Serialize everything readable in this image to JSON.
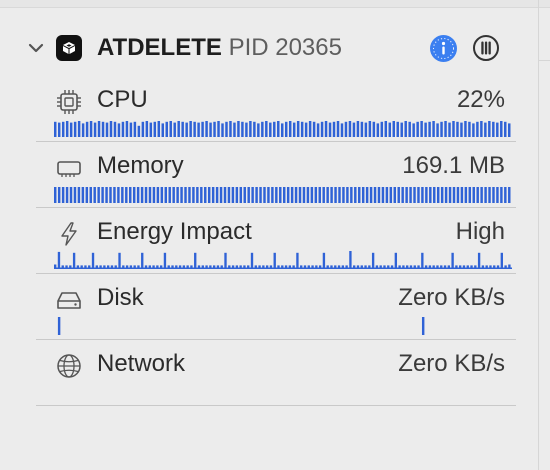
{
  "process": {
    "name": "ATDELETE",
    "pid_text": "PID 20365"
  },
  "icons": {
    "chevron": "chevron-down-icon",
    "app": "app-cube-icon",
    "info": "info-icon",
    "pause": "pause-icon",
    "cpu": "cpu-chip-icon",
    "memory": "memory-icon",
    "energy": "bolt-icon",
    "disk": "disk-icon",
    "network": "globe-icon"
  },
  "colors": {
    "bar": "#2f62d6",
    "accent": "#3b7ff0",
    "background": "#ececec"
  },
  "metrics": [
    {
      "label": "CPU",
      "value": "22%",
      "graph": [
        0.95,
        0.9,
        0.95,
        1,
        0.9,
        0.95,
        1,
        0.85,
        0.95,
        1,
        0.9,
        1,
        0.95,
        0.9,
        1,
        0.95,
        0.85,
        0.95,
        1,
        0.9,
        0.95,
        0.7,
        0.95,
        1,
        0.9,
        0.95,
        1,
        0.85,
        0.95,
        1,
        0.9,
        1,
        0.95,
        0.9,
        1,
        0.95,
        0.9,
        0.95,
        1,
        0.9,
        0.95,
        1,
        0.85,
        0.95,
        1,
        0.9,
        1,
        0.95,
        0.9,
        1,
        0.95,
        0.85,
        0.95,
        1,
        0.9,
        0.95,
        1,
        0.85,
        0.95,
        1,
        0.9,
        1,
        0.95,
        0.9,
        1,
        0.95,
        0.85,
        0.95,
        1,
        0.9,
        0.95,
        1,
        0.85,
        0.95,
        1,
        0.9,
        1,
        0.95,
        0.9,
        1,
        0.95,
        0.85,
        0.95,
        1,
        0.9,
        1,
        0.95,
        0.9,
        1,
        0.95,
        0.85,
        0.95,
        1,
        0.9,
        0.95,
        1,
        0.85,
        0.95,
        1,
        0.9,
        1,
        0.95,
        0.9,
        1,
        0.95,
        0.85,
        0.95,
        1,
        0.9,
        1,
        0.95,
        0.9,
        1,
        0.95,
        0.85
      ]
    },
    {
      "label": "Memory",
      "value": "169.1 MB",
      "graph": [
        1,
        1,
        1,
        1,
        1,
        1,
        1,
        1,
        1,
        1,
        1,
        1,
        1,
        1,
        1,
        1,
        1,
        1,
        1,
        1,
        1,
        1,
        1,
        1,
        1,
        1,
        1,
        1,
        1,
        1,
        1,
        1,
        1,
        1,
        1,
        1,
        1,
        1,
        1,
        1,
        1,
        1,
        1,
        1,
        1,
        1,
        1,
        1,
        1,
        1,
        1,
        1,
        1,
        1,
        1,
        1,
        1,
        1,
        1,
        1,
        1,
        1,
        1,
        1,
        1,
        1,
        1,
        1,
        1,
        1,
        1,
        1,
        1,
        1,
        1,
        1,
        1,
        1,
        1,
        1,
        1,
        1,
        1,
        1,
        1,
        1,
        1,
        1,
        1,
        1,
        1,
        1,
        1,
        1,
        1,
        1,
        1,
        1,
        1,
        1,
        1,
        1,
        1,
        1,
        1,
        1,
        1,
        1,
        1,
        1,
        1,
        1,
        1,
        1,
        1,
        1
      ]
    },
    {
      "label": "Energy Impact",
      "value": "High",
      "graph": [
        0.25,
        0.95,
        0.2,
        0.2,
        0.2,
        0.9,
        0.2,
        0.2,
        0.2,
        0.2,
        0.9,
        0.2,
        0.2,
        0.2,
        0.2,
        0.2,
        0.2,
        0.9,
        0.2,
        0.2,
        0.2,
        0.2,
        0.2,
        0.9,
        0.2,
        0.2,
        0.2,
        0.2,
        0.2,
        0.9,
        0.2,
        0.2,
        0.2,
        0.2,
        0.2,
        0.2,
        0.2,
        0.9,
        0.2,
        0.2,
        0.2,
        0.2,
        0.2,
        0.2,
        0.2,
        0.9,
        0.2,
        0.2,
        0.2,
        0.2,
        0.2,
        0.2,
        0.9,
        0.2,
        0.2,
        0.2,
        0.2,
        0.2,
        0.9,
        0.2,
        0.2,
        0.2,
        0.2,
        0.2,
        0.9,
        0.2,
        0.2,
        0.2,
        0.2,
        0.2,
        0.2,
        0.9,
        0.2,
        0.2,
        0.2,
        0.2,
        0.2,
        0.2,
        1,
        0.2,
        0.2,
        0.2,
        0.2,
        0.2,
        0.9,
        0.2,
        0.2,
        0.2,
        0.2,
        0.2,
        0.9,
        0.2,
        0.2,
        0.2,
        0.2,
        0.2,
        0.2,
        0.9,
        0.2,
        0.2,
        0.2,
        0.2,
        0.2,
        0.2,
        0.2,
        0.9,
        0.2,
        0.2,
        0.2,
        0.2,
        0.2,
        0.2,
        0.9,
        0.2,
        0.2,
        0.2,
        0.2,
        0.2,
        0.9,
        0.2,
        0.25
      ]
    },
    {
      "label": "Disk",
      "value": "Zero KB/s",
      "graph": [
        0,
        1,
        0,
        0,
        0,
        0,
        0,
        0,
        0,
        0,
        0,
        0,
        0,
        0,
        0,
        0,
        0,
        0,
        0,
        0,
        0,
        0,
        0,
        0,
        0,
        0,
        0,
        0,
        0,
        0,
        0,
        0,
        0,
        0,
        0,
        0,
        0,
        0,
        0,
        0,
        0,
        0,
        0,
        0,
        0,
        0,
        0,
        0,
        0,
        0,
        0,
        0,
        0,
        0,
        0,
        0,
        0,
        0,
        0,
        0,
        0,
        0,
        0,
        0,
        0,
        0,
        0,
        0,
        0,
        0,
        0,
        0,
        0,
        0,
        0,
        0,
        0,
        0,
        0,
        0,
        0,
        0,
        0,
        0,
        0,
        0,
        0,
        0,
        0,
        0,
        0,
        0,
        0,
        0,
        1,
        0,
        0,
        0,
        0,
        0,
        0,
        0,
        0,
        0,
        0,
        0,
        0,
        0,
        0,
        0,
        0,
        0,
        0,
        0,
        0,
        0,
        0
      ]
    },
    {
      "label": "Network",
      "value": "Zero KB/s",
      "graph": []
    }
  ]
}
